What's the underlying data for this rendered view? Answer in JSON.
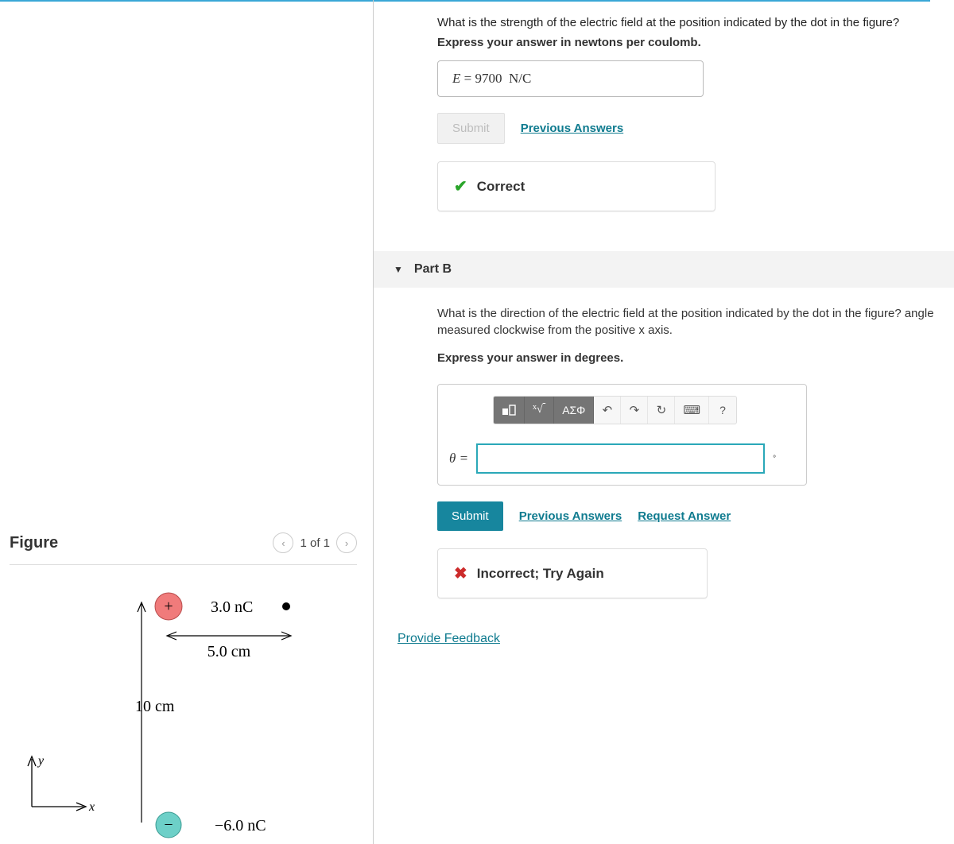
{
  "partA": {
    "question": "What is the strength of the electric field at the position indicated by the dot in the figure?",
    "instruction": "Express your answer in newtons per coulomb.",
    "answer_var": "E",
    "answer_eq": " = ",
    "answer_value": "9700",
    "answer_unit": "N/C",
    "submit_label": "Submit",
    "prev_label": "Previous Answers",
    "feedback": "Correct"
  },
  "partB": {
    "header": "Part B",
    "question": "What is the direction of the electric field at the position indicated by the dot in the figure? angle measured clockwise from the positive x axis.",
    "instruction": "Express your answer in degrees.",
    "toolbar": {
      "greek": "ΑΣΦ",
      "help": "?"
    },
    "theta_label": "θ = ",
    "unit": "°",
    "submit_label": "Submit",
    "prev_label": "Previous Answers",
    "request_label": "Request Answer",
    "feedback": "Incorrect; Try Again"
  },
  "feedback_link": "Provide Feedback",
  "figure": {
    "title": "Figure",
    "nav_text": "1 of 1",
    "charge_pos_label": "3.0 nC",
    "charge_neg_label": "−6.0 nC",
    "dist_h": "5.0 cm",
    "dist_v": "10 cm",
    "axis_x": "x",
    "axis_y": "y",
    "plus": "+",
    "minus": "−"
  }
}
